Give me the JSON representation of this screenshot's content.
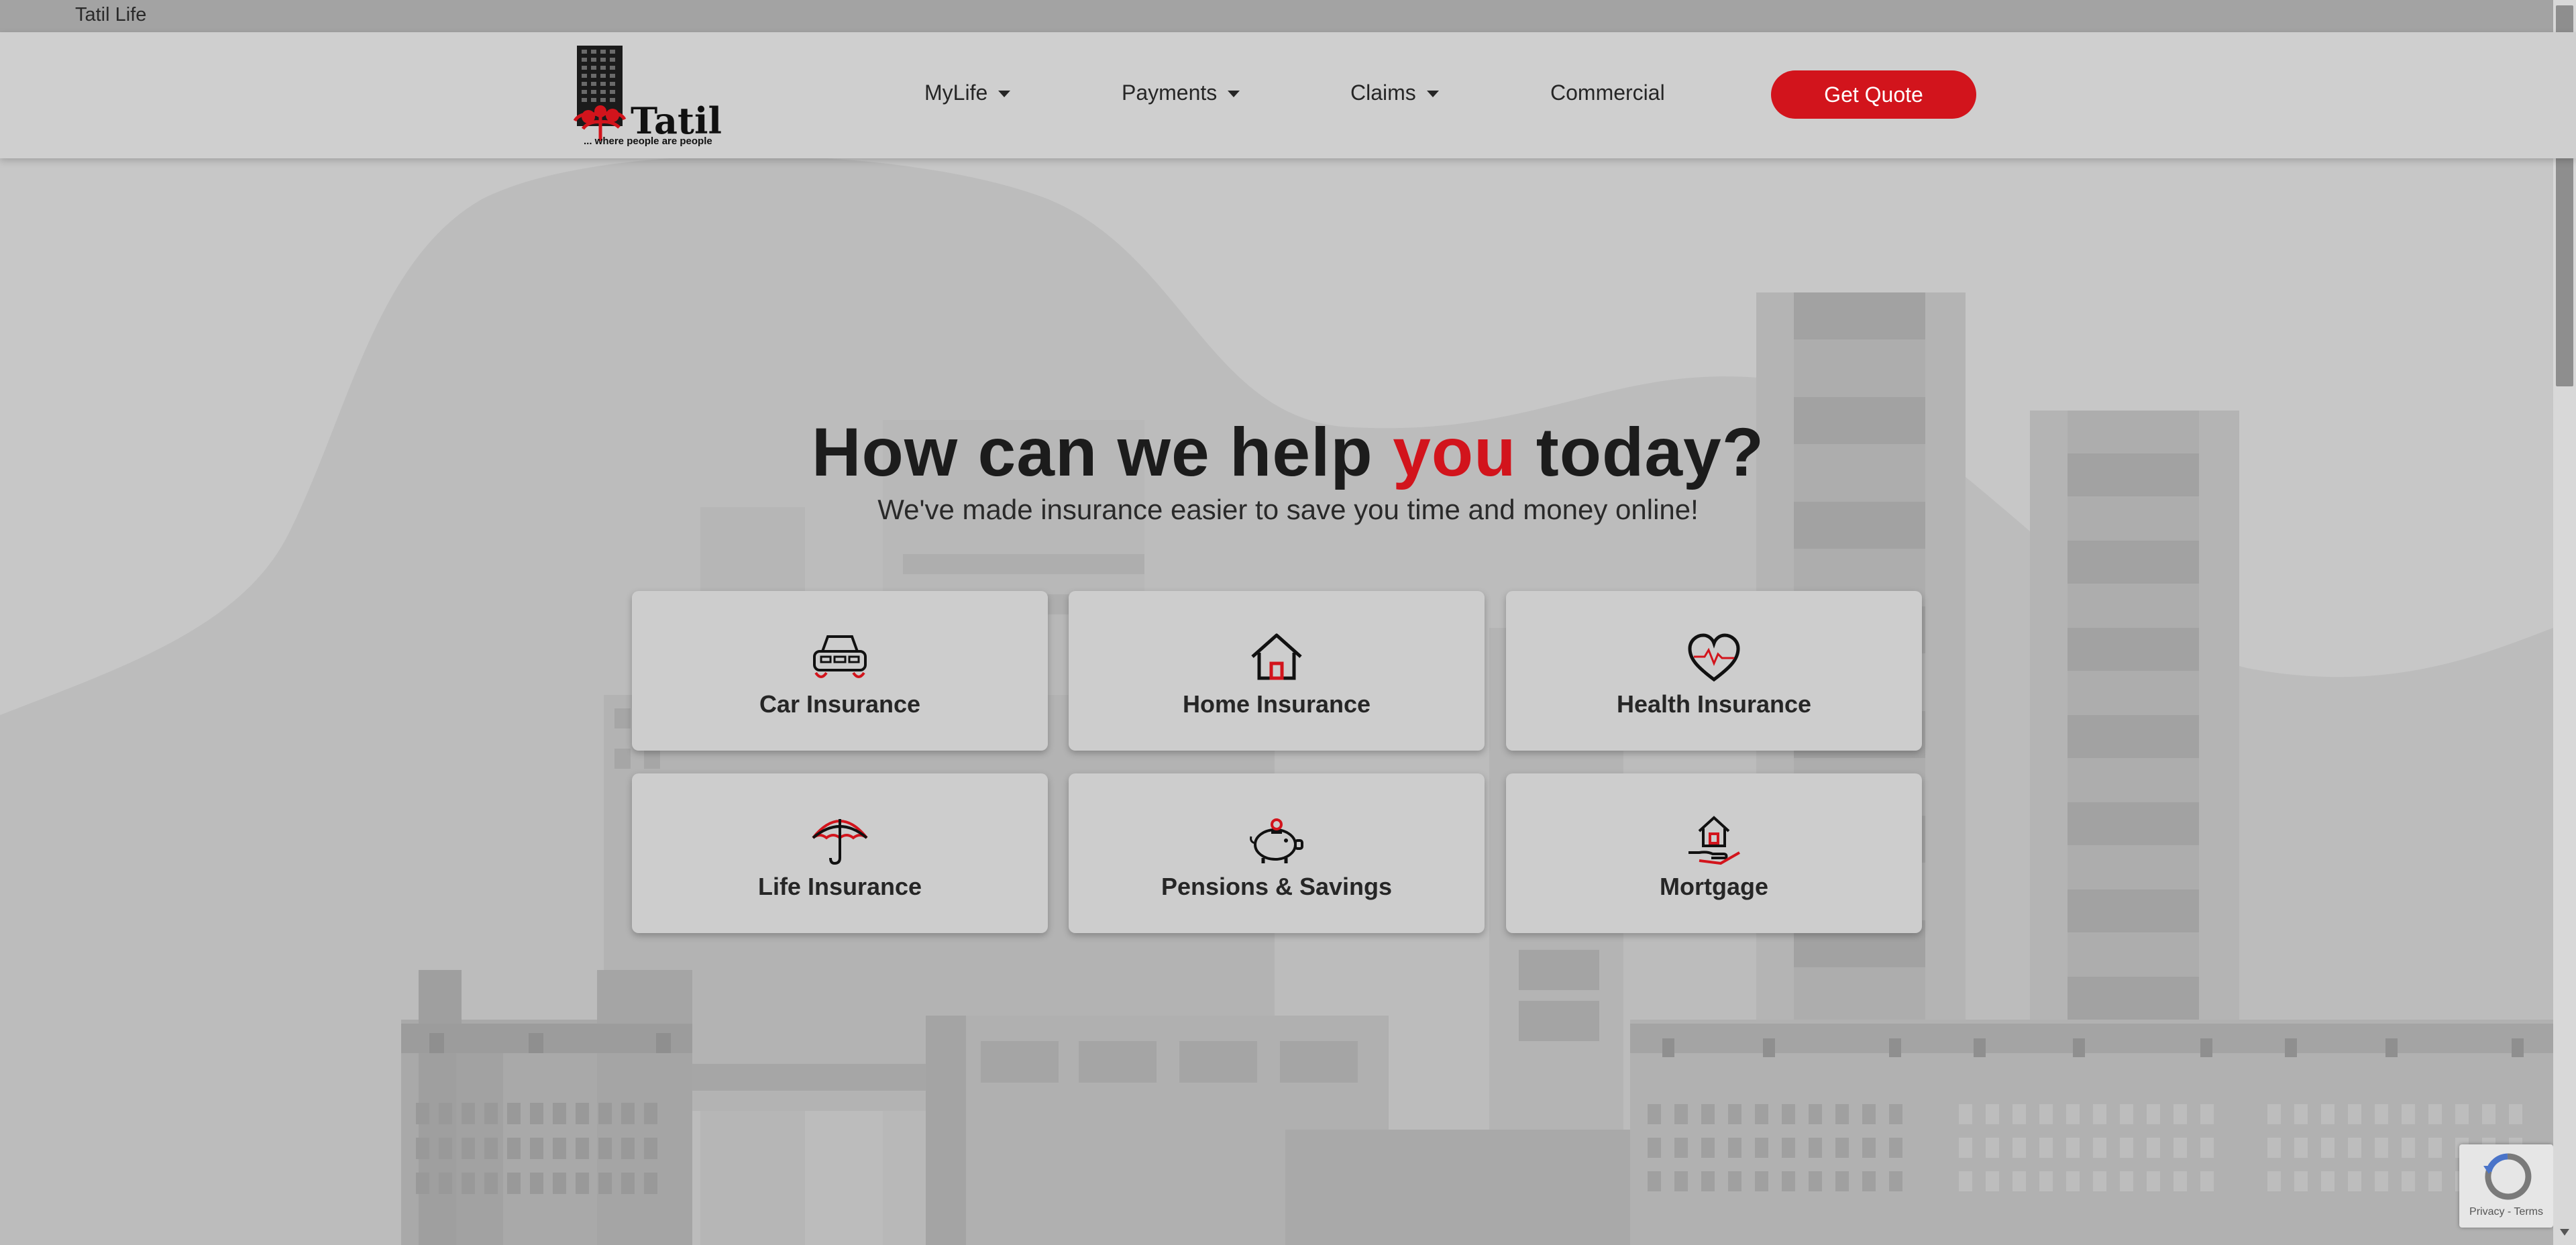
{
  "topbar": {
    "brand": "Tatil Life"
  },
  "logo": {
    "wordmark": "Tatil",
    "tagline": "... where people are people"
  },
  "nav": {
    "items": [
      {
        "label": "MyLife",
        "dropdown": true
      },
      {
        "label": "Payments",
        "dropdown": true
      },
      {
        "label": "Claims",
        "dropdown": true
      },
      {
        "label": "Commercial",
        "dropdown": false
      }
    ],
    "cta": "Get Quote"
  },
  "hero": {
    "title_before": "How can we help ",
    "title_accent": "you",
    "title_after": " today?",
    "subtitle": "We've made insurance easier to save you time and money online!"
  },
  "cards": [
    {
      "label": "Car Insurance",
      "icon": "car-icon"
    },
    {
      "label": "Home Insurance",
      "icon": "house-icon"
    },
    {
      "label": "Health Insurance",
      "icon": "heart-pulse-icon"
    },
    {
      "label": "Life Insurance",
      "icon": "umbrella-icon"
    },
    {
      "label": "Pensions & Savings",
      "icon": "piggy-bank-icon"
    },
    {
      "label": "Mortgage",
      "icon": "house-in-hand-icon"
    }
  ],
  "recaptcha": {
    "links": "Privacy - Terms"
  },
  "colors": {
    "accent": "#d2141c",
    "overlay_bg": "#c7c7c7",
    "navbar_bg": "#cfcfcf",
    "topstrip_bg": "#a3a3a3"
  }
}
